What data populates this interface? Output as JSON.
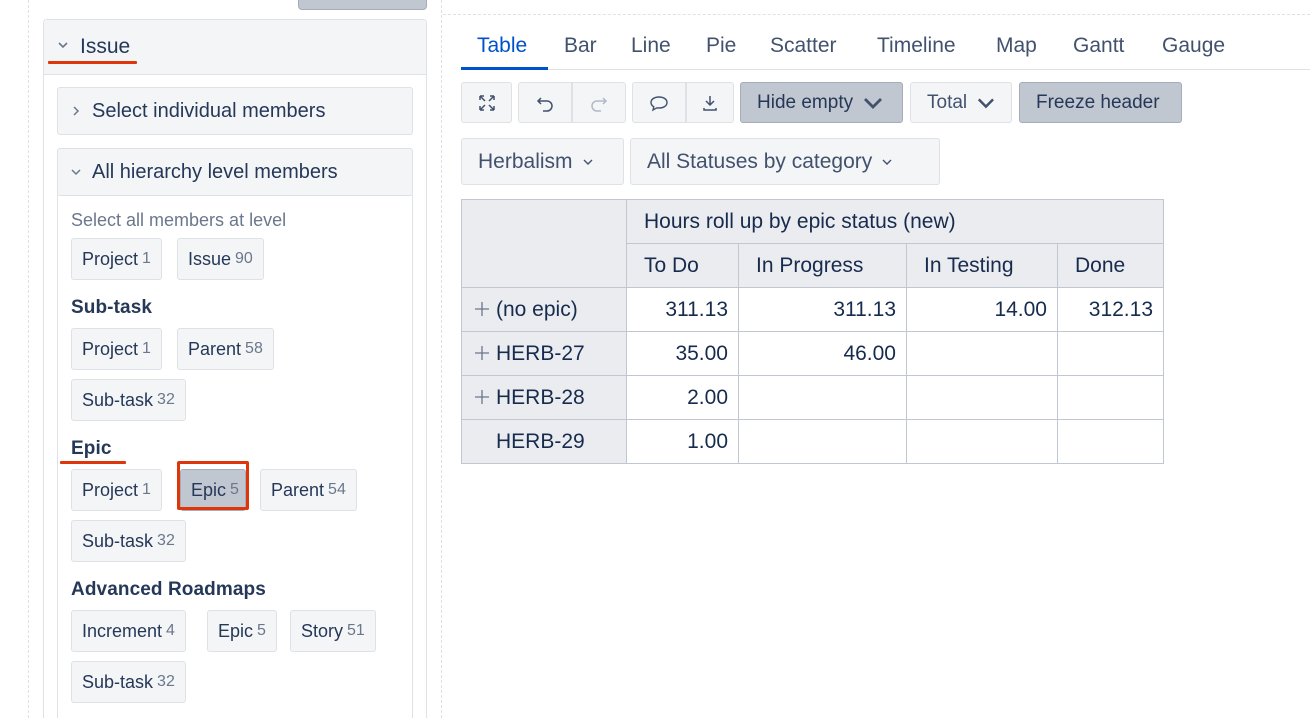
{
  "sidebar": {
    "issue_title": "Issue",
    "select_individual_label": "Select individual members",
    "all_hierarchy_label": "All hierarchy level members",
    "select_all_text": "Select all members at level",
    "root_chips": [
      {
        "label": "Project",
        "count": "1"
      },
      {
        "label": "Issue",
        "count": "90"
      }
    ],
    "groups": [
      {
        "title": "Sub-task",
        "chips": [
          {
            "label": "Project",
            "count": "1"
          },
          {
            "label": "Parent",
            "count": "58"
          },
          {
            "label": "Sub-task",
            "count": "32"
          }
        ]
      },
      {
        "title": "Epic",
        "chips": [
          {
            "label": "Project",
            "count": "1"
          },
          {
            "label": "Epic",
            "count": "5",
            "selected": true
          },
          {
            "label": "Parent",
            "count": "54"
          },
          {
            "label": "Sub-task",
            "count": "32"
          }
        ]
      },
      {
        "title": "Advanced Roadmaps",
        "chips": [
          {
            "label": "Increment",
            "count": "4"
          },
          {
            "label": "Epic",
            "count": "5"
          },
          {
            "label": "Story",
            "count": "51"
          },
          {
            "label": "Sub-task",
            "count": "32"
          }
        ]
      }
    ]
  },
  "tabs": [
    "Table",
    "Bar",
    "Line",
    "Pie",
    "Scatter",
    "Timeline",
    "Map",
    "Gantt",
    "Gauge"
  ],
  "active_tab": "Table",
  "toolbar": {
    "expand_icon": "expand-icon",
    "undo_icon": "undo-icon",
    "redo_icon": "redo-icon",
    "comment_icon": "comment-icon",
    "download_icon": "download-icon",
    "hide_empty_label": "Hide empty",
    "total_label": "Total",
    "freeze_header_label": "Freeze header"
  },
  "filters": {
    "project": "Herbalism",
    "status": "All Statuses by category"
  },
  "table": {
    "measure_header": "Hours roll up by epic status (new)",
    "columns": [
      "To Do",
      "In Progress",
      "In Testing",
      "Done"
    ],
    "rows": [
      {
        "label": "(no epic)",
        "expandable": true,
        "values": [
          "311.13",
          "311.13",
          "14.00",
          "312.13"
        ]
      },
      {
        "label": "HERB-27",
        "expandable": true,
        "values": [
          "35.00",
          "46.00",
          "",
          ""
        ]
      },
      {
        "label": "HERB-28",
        "expandable": true,
        "values": [
          "2.00",
          "",
          "",
          ""
        ]
      },
      {
        "label": "HERB-29",
        "expandable": false,
        "values": [
          "1.00",
          "",
          "",
          ""
        ]
      }
    ]
  },
  "colors": {
    "accent": "#0052cc",
    "highlight": "#de350b",
    "selected_chip": "#c1c7d0"
  }
}
